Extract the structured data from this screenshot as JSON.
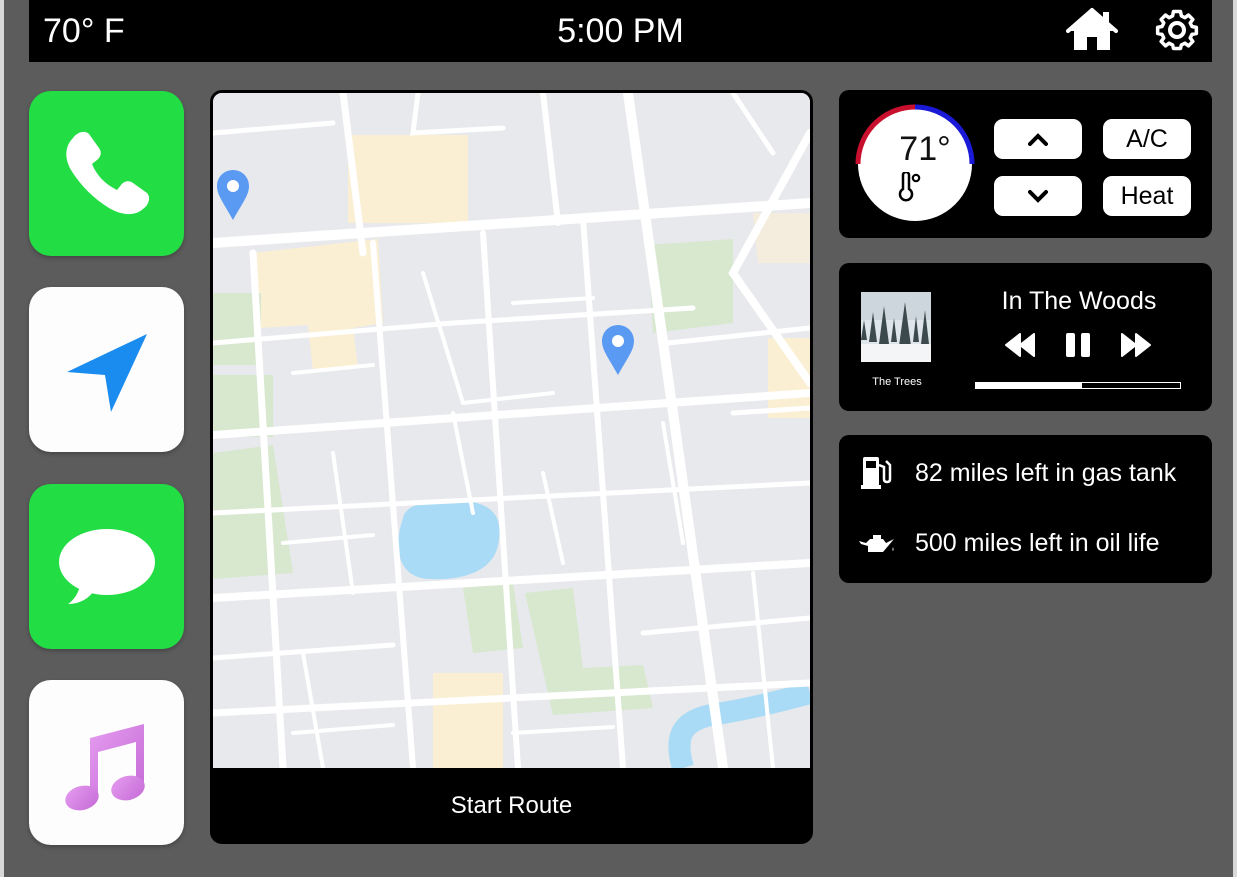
{
  "status_bar": {
    "outside_temp": "70° F",
    "time": "5:00 PM",
    "icons": [
      "home-icon",
      "gear-icon"
    ]
  },
  "apps": [
    {
      "id": "phone",
      "icon": "phone-icon"
    },
    {
      "id": "navigation",
      "icon": "navigation-arrow-icon"
    },
    {
      "id": "messages",
      "icon": "message-bubble-icon"
    },
    {
      "id": "music",
      "icon": "music-note-icon"
    }
  ],
  "map": {
    "pins": 2,
    "start_route_label": "Start Route"
  },
  "climate": {
    "set_temp": "71°",
    "up_icon": "chevron-up-icon",
    "down_icon": "chevron-down-icon",
    "ac_label": "A/C",
    "heat_label": "Heat"
  },
  "media": {
    "song_title": "In The Woods",
    "album_name": "The Trees",
    "progress_fraction": 0.52,
    "controls": [
      "rewind-icon",
      "pause-icon",
      "fast-forward-icon"
    ]
  },
  "vehicle_info": {
    "gas_text": "82 miles left in gas tank",
    "oil_text": "500 miles left in oil life"
  },
  "colors": {
    "app_green": "#22dd44",
    "nav_blue": "#1a8cf0",
    "music_purple": "#d17fe0",
    "dial_red": "#c8102e",
    "dial_blue": "#1a1ad6"
  }
}
